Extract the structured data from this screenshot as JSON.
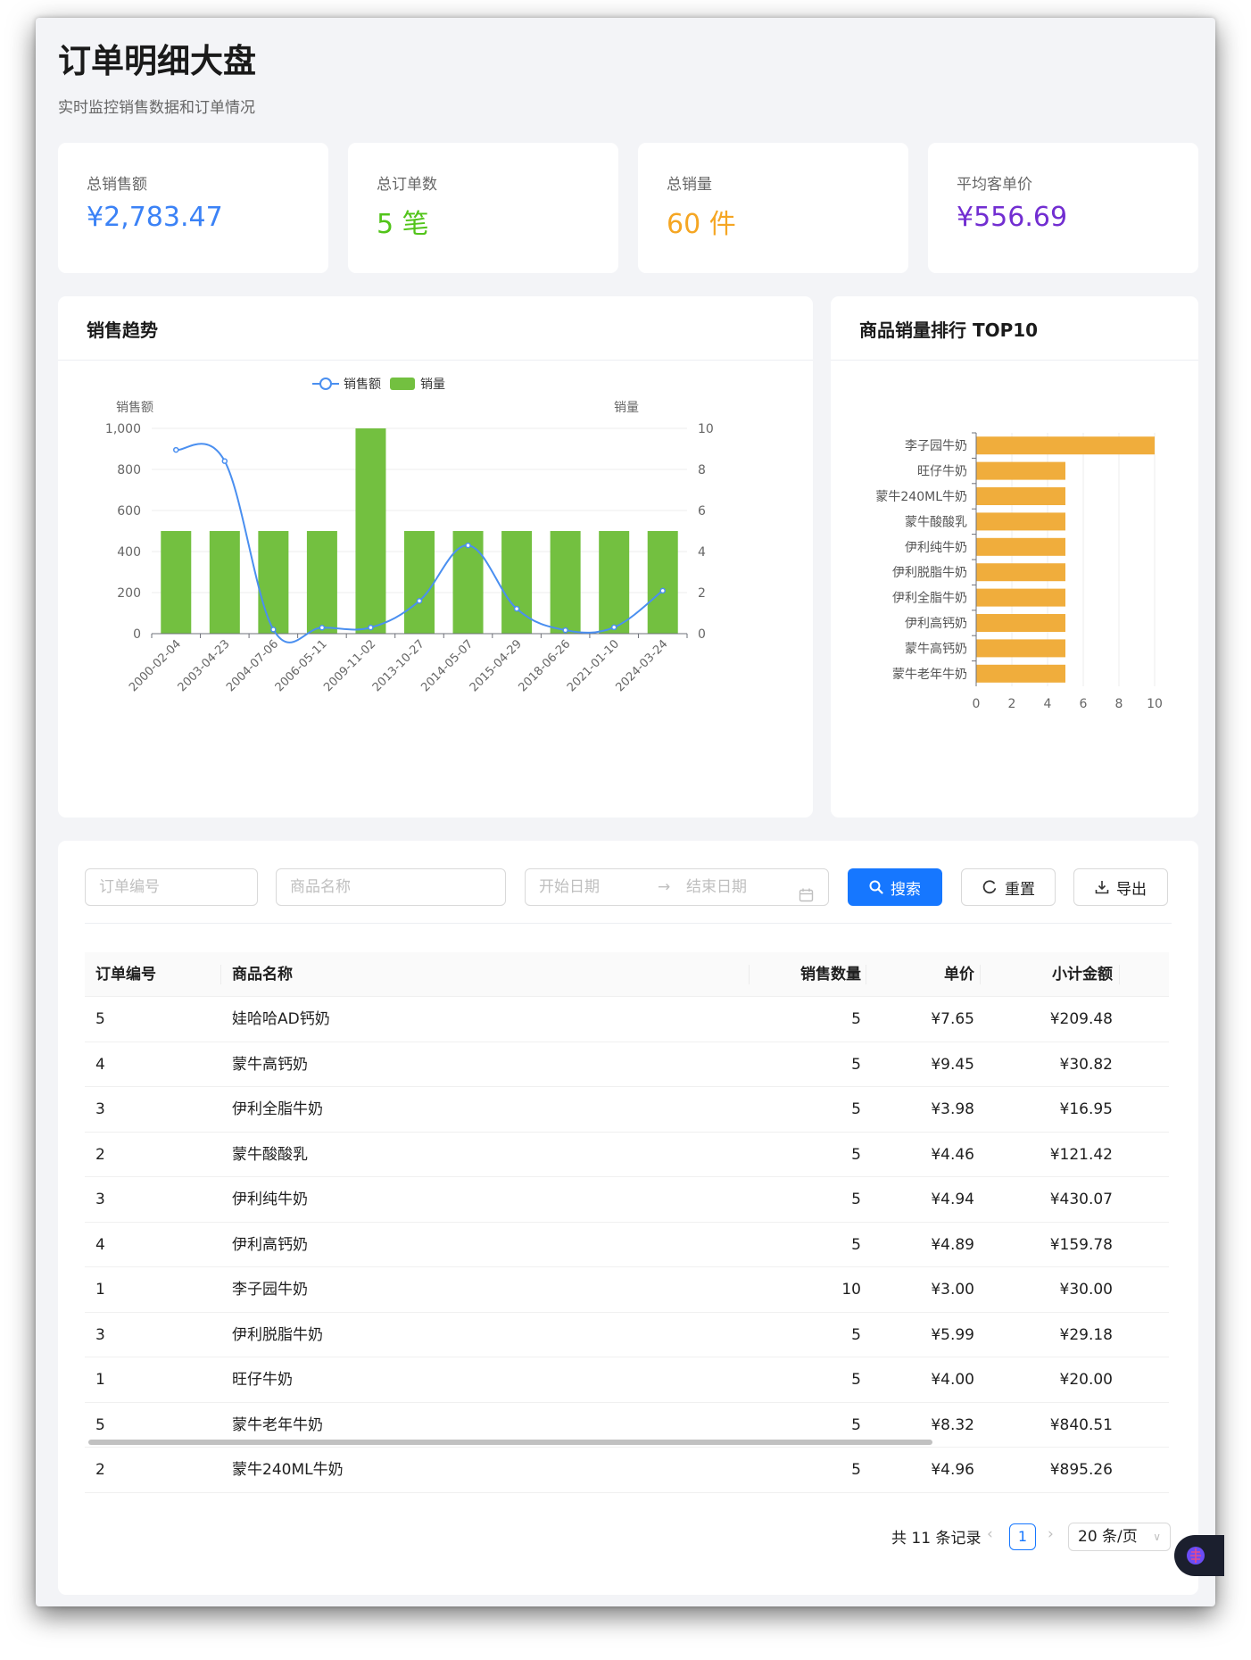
{
  "header": {
    "title": "订单明细大盘",
    "subtitle": "实时监控销售数据和订单情况"
  },
  "stats": [
    {
      "label": "总销售额",
      "value": "¥2,783.47",
      "color": "#3b82f6"
    },
    {
      "label": "总订单数",
      "value": "5 笔",
      "color": "#52c41a"
    },
    {
      "label": "总销量",
      "value": "60 件",
      "color": "#f5a623"
    },
    {
      "label": "平均客单价",
      "value": "¥556.69",
      "color": "#722ed1"
    }
  ],
  "trend": {
    "title": "销售趋势"
  },
  "top10": {
    "title": "商品销量排行 TOP10"
  },
  "chart_data": [
    {
      "type": "bar+line",
      "legend": [
        "销售额",
        "销量"
      ],
      "legend_position": "top-center",
      "ylabel_left": "销售额",
      "ylabel_right": "销量",
      "categories": [
        "2000-02-04",
        "2003-04-23",
        "2004-07-06",
        "2006-05-11",
        "2009-11-02",
        "2013-10-27",
        "2014-05-07",
        "2015-04-29",
        "2018-06-26",
        "2021-01-10",
        "2024-03-24"
      ],
      "series": [
        {
          "name": "销量",
          "type": "bar",
          "axis": "right",
          "color": "#73c040",
          "values": [
            5,
            5,
            5,
            5,
            10,
            5,
            5,
            5,
            5,
            5,
            5
          ]
        },
        {
          "name": "销售额",
          "type": "line",
          "axis": "left",
          "color": "#4a8ff0",
          "values": [
            895.26,
            840.51,
            20,
            29.18,
            30,
            159.78,
            430.07,
            121.42,
            16.95,
            30.82,
            209.48
          ]
        }
      ],
      "left_ticks": [
        "0",
        "200",
        "400",
        "600",
        "800",
        "1,000"
      ],
      "right_ticks": [
        "0",
        "2",
        "4",
        "6",
        "8",
        "10"
      ],
      "ylim_left": [
        0,
        1000
      ],
      "ylim_right": [
        0,
        10
      ],
      "grid": true
    },
    {
      "type": "bar",
      "orientation": "horizontal",
      "color": "#f0ad3c",
      "categories": [
        "李子园牛奶",
        "旺仔牛奶",
        "蒙牛240ML牛奶",
        "蒙牛酸酸乳",
        "伊利纯牛奶",
        "伊利脱脂牛奶",
        "伊利全脂牛奶",
        "伊利高钙奶",
        "蒙牛高钙奶",
        "蒙牛老年牛奶"
      ],
      "values": [
        10,
        5,
        5,
        5,
        5,
        5,
        5,
        5,
        5,
        5
      ],
      "x_ticks": [
        "0",
        "2",
        "4",
        "6",
        "8",
        "10"
      ],
      "xlim": [
        0,
        10
      ],
      "grid": true
    }
  ],
  "filters": {
    "order_no_placeholder": "订单编号",
    "product_placeholder": "商品名称",
    "start_date_placeholder": "开始日期",
    "end_date_placeholder": "结束日期",
    "search_label": "搜索",
    "reset_label": "重置",
    "export_label": "导出"
  },
  "table": {
    "headers": [
      "订单编号",
      "商品名称",
      "销售数量",
      "单价",
      "小计金额"
    ],
    "rows": [
      [
        "5",
        "娃哈哈AD钙奶",
        "5",
        "¥7.65",
        "¥209.48"
      ],
      [
        "4",
        "蒙牛高钙奶",
        "5",
        "¥9.45",
        "¥30.82"
      ],
      [
        "3",
        "伊利全脂牛奶",
        "5",
        "¥3.98",
        "¥16.95"
      ],
      [
        "2",
        "蒙牛酸酸乳",
        "5",
        "¥4.46",
        "¥121.42"
      ],
      [
        "3",
        "伊利纯牛奶",
        "5",
        "¥4.94",
        "¥430.07"
      ],
      [
        "4",
        "伊利高钙奶",
        "5",
        "¥4.89",
        "¥159.78"
      ],
      [
        "1",
        "李子园牛奶",
        "10",
        "¥3.00",
        "¥30.00"
      ],
      [
        "3",
        "伊利脱脂牛奶",
        "5",
        "¥5.99",
        "¥29.18"
      ],
      [
        "1",
        "旺仔牛奶",
        "5",
        "¥4.00",
        "¥20.00"
      ],
      [
        "5",
        "蒙牛老年牛奶",
        "5",
        "¥8.32",
        "¥840.51"
      ],
      [
        "2",
        "蒙牛240ML牛奶",
        "5",
        "¥4.96",
        "¥895.26"
      ]
    ]
  },
  "pagination": {
    "total_text": "共 11 条记录",
    "current_page": "1",
    "page_size": "20 条/页"
  }
}
